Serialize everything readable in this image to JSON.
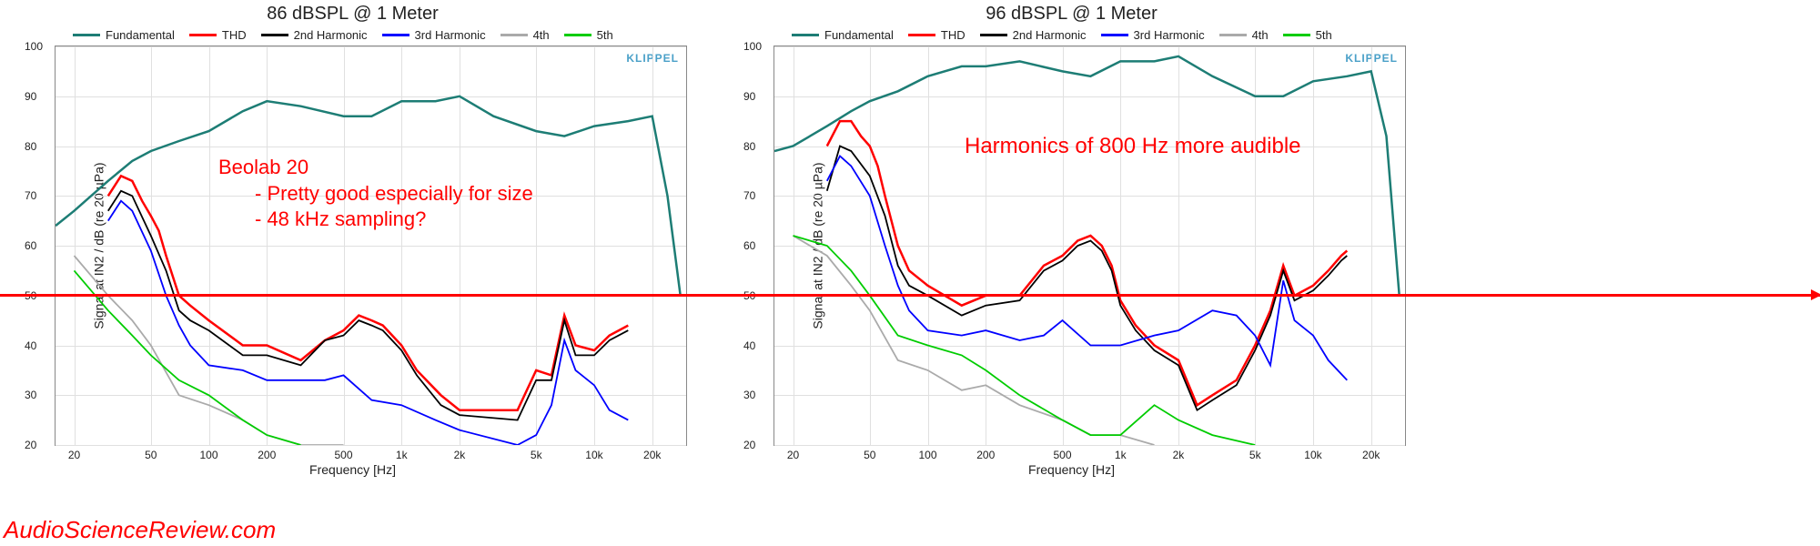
{
  "source_watermark": "AudioScienceReview.com",
  "brand_label": "KLIPPEL",
  "reference_line_db": 50,
  "chart_data": [
    {
      "type": "line",
      "title": "86 dBSPL @ 1 Meter",
      "xlabel": "Frequency [Hz]",
      "ylabel": "Signal at IN2 / dB (re 20 µPa)",
      "xscale": "log",
      "xlim": [
        16,
        30000
      ],
      "ylim": [
        20,
        100
      ],
      "xticks": [
        20,
        50,
        100,
        200,
        500,
        1000,
        2000,
        5000,
        10000,
        20000
      ],
      "xtick_labels": [
        "20",
        "50",
        "100",
        "200",
        "500",
        "1k",
        "2k",
        "5k",
        "10k",
        "20k"
      ],
      "yticks": [
        20,
        30,
        40,
        50,
        60,
        70,
        80,
        90,
        100
      ],
      "legend": [
        {
          "name": "Fundamental",
          "color": "#1d7d75"
        },
        {
          "name": "THD",
          "color": "#ff0000"
        },
        {
          "name": "2nd Harmonic",
          "color": "#000000"
        },
        {
          "name": "3rd Harmonic",
          "color": "#0000ff"
        },
        {
          "name": "4th",
          "color": "#aaaaaa"
        },
        {
          "name": "5th",
          "color": "#00cc00"
        }
      ],
      "annotations": [
        "Beolab 20",
        "- Pretty good especially for size",
        "- 48 kHz sampling?"
      ],
      "series": [
        {
          "name": "Fundamental",
          "color": "#1d7d75",
          "x": [
            16,
            20,
            30,
            40,
            50,
            70,
            100,
            150,
            200,
            300,
            500,
            700,
            1000,
            1500,
            2000,
            3000,
            5000,
            7000,
            10000,
            15000,
            20000,
            24000,
            28000
          ],
          "y": [
            64,
            67,
            73,
            77,
            79,
            81,
            83,
            87,
            89,
            88,
            86,
            86,
            89,
            89,
            90,
            86,
            83,
            82,
            84,
            85,
            86,
            70,
            50
          ]
        },
        {
          "name": "THD",
          "color": "#ff0000",
          "x": [
            30,
            35,
            40,
            45,
            50,
            55,
            60,
            70,
            80,
            100,
            150,
            200,
            300,
            400,
            500,
            600,
            700,
            800,
            1000,
            1200,
            1600,
            2000,
            4000,
            5000,
            6000,
            7000,
            8000,
            10000,
            12000,
            15000
          ],
          "y": [
            70,
            74,
            73,
            69,
            66,
            63,
            58,
            50,
            48,
            45,
            40,
            40,
            37,
            41,
            43,
            46,
            45,
            44,
            40,
            35,
            30,
            27,
            27,
            35,
            34,
            46,
            40,
            39,
            42,
            44
          ]
        },
        {
          "name": "2nd Harmonic",
          "color": "#000000",
          "x": [
            30,
            35,
            40,
            50,
            60,
            70,
            80,
            100,
            150,
            200,
            300,
            400,
            500,
            600,
            700,
            800,
            1000,
            1200,
            1600,
            2000,
            4000,
            5000,
            6000,
            7000,
            8000,
            10000,
            12000,
            15000
          ],
          "y": [
            67,
            71,
            70,
            62,
            55,
            47,
            45,
            43,
            38,
            38,
            36,
            41,
            42,
            45,
            44,
            43,
            39,
            34,
            28,
            26,
            25,
            33,
            33,
            45,
            38,
            38,
            41,
            43
          ]
        },
        {
          "name": "3rd Harmonic",
          "color": "#0000ff",
          "x": [
            30,
            35,
            40,
            50,
            60,
            70,
            80,
            100,
            150,
            200,
            300,
            400,
            500,
            700,
            1000,
            1500,
            2000,
            4000,
            5000,
            6000,
            7000,
            8000,
            10000,
            12000,
            15000
          ],
          "y": [
            65,
            69,
            67,
            59,
            50,
            44,
            40,
            36,
            35,
            33,
            33,
            33,
            34,
            29,
            28,
            25,
            23,
            20,
            22,
            28,
            41,
            35,
            32,
            27,
            25
          ]
        },
        {
          "name": "4th",
          "color": "#aaaaaa",
          "x": [
            20,
            30,
            40,
            50,
            70,
            100,
            150,
            200,
            300,
            500
          ],
          "y": [
            58,
            50,
            45,
            40,
            30,
            28,
            25,
            22,
            20,
            20
          ]
        },
        {
          "name": "5th",
          "color": "#00cc00",
          "x": [
            20,
            30,
            40,
            50,
            70,
            100,
            150,
            200,
            300
          ],
          "y": [
            55,
            47,
            42,
            38,
            33,
            30,
            25,
            22,
            20
          ]
        }
      ]
    },
    {
      "type": "line",
      "title": "96 dBSPL @ 1 Meter",
      "xlabel": "Frequency [Hz]",
      "ylabel": "Signal at IN2 / dB (re 20 µPa)",
      "xscale": "log",
      "xlim": [
        16,
        30000
      ],
      "ylim": [
        20,
        100
      ],
      "xticks": [
        20,
        50,
        100,
        200,
        500,
        1000,
        2000,
        5000,
        10000,
        20000
      ],
      "xtick_labels": [
        "20",
        "50",
        "100",
        "200",
        "500",
        "1k",
        "2k",
        "5k",
        "10k",
        "20k"
      ],
      "yticks": [
        20,
        30,
        40,
        50,
        60,
        70,
        80,
        90,
        100
      ],
      "legend": [
        {
          "name": "Fundamental",
          "color": "#1d7d75"
        },
        {
          "name": "THD",
          "color": "#ff0000"
        },
        {
          "name": "2nd Harmonic",
          "color": "#000000"
        },
        {
          "name": "3rd Harmonic",
          "color": "#0000ff"
        },
        {
          "name": "4th",
          "color": "#aaaaaa"
        },
        {
          "name": "5th",
          "color": "#00cc00"
        }
      ],
      "annotations": [
        "Harmonics of 800 Hz more audible"
      ],
      "series": [
        {
          "name": "Fundamental",
          "color": "#1d7d75",
          "x": [
            16,
            20,
            30,
            40,
            50,
            70,
            100,
            150,
            200,
            300,
            500,
            700,
            1000,
            1500,
            2000,
            3000,
            5000,
            7000,
            10000,
            15000,
            20000,
            24000,
            28000
          ],
          "y": [
            79,
            80,
            84,
            87,
            89,
            91,
            94,
            96,
            96,
            97,
            95,
            94,
            97,
            97,
            98,
            94,
            90,
            90,
            93,
            94,
            95,
            82,
            50
          ]
        },
        {
          "name": "THD",
          "color": "#ff0000",
          "x": [
            30,
            35,
            40,
            45,
            50,
            55,
            60,
            70,
            80,
            100,
            150,
            200,
            300,
            400,
            500,
            600,
            700,
            800,
            900,
            1000,
            1200,
            1500,
            2000,
            2500,
            3000,
            4000,
            5000,
            6000,
            7000,
            8000,
            10000,
            12000,
            14000,
            15000
          ],
          "y": [
            80,
            85,
            85,
            82,
            80,
            76,
            70,
            60,
            55,
            52,
            48,
            50,
            50,
            56,
            58,
            61,
            62,
            60,
            56,
            49,
            44,
            40,
            37,
            28,
            30,
            33,
            40,
            47,
            56,
            50,
            52,
            55,
            58,
            59
          ]
        },
        {
          "name": "2nd Harmonic",
          "color": "#000000",
          "x": [
            30,
            35,
            40,
            50,
            60,
            70,
            80,
            100,
            150,
            200,
            300,
            400,
            500,
            600,
            700,
            800,
            900,
            1000,
            1200,
            1500,
            2000,
            2500,
            3000,
            4000,
            5000,
            6000,
            7000,
            8000,
            10000,
            12000,
            14000,
            15000
          ],
          "y": [
            71,
            80,
            79,
            74,
            66,
            56,
            52,
            50,
            46,
            48,
            49,
            55,
            57,
            60,
            61,
            59,
            55,
            48,
            43,
            39,
            36,
            27,
            29,
            32,
            39,
            46,
            55,
            49,
            51,
            54,
            57,
            58
          ]
        },
        {
          "name": "3rd Harmonic",
          "color": "#0000ff",
          "x": [
            30,
            35,
            40,
            50,
            60,
            70,
            80,
            100,
            150,
            200,
            300,
            400,
            500,
            700,
            1000,
            1500,
            2000,
            3000,
            4000,
            5000,
            6000,
            7000,
            8000,
            10000,
            12000,
            15000
          ],
          "y": [
            73,
            78,
            76,
            70,
            60,
            52,
            47,
            43,
            42,
            43,
            41,
            42,
            45,
            40,
            40,
            42,
            43,
            47,
            46,
            42,
            36,
            53,
            45,
            42,
            37,
            33
          ]
        },
        {
          "name": "4th",
          "color": "#aaaaaa",
          "x": [
            20,
            30,
            40,
            50,
            70,
            100,
            150,
            200,
            300,
            500,
            700,
            1000,
            1500
          ],
          "y": [
            62,
            58,
            52,
            47,
            37,
            35,
            31,
            32,
            28,
            25,
            22,
            22,
            20
          ]
        },
        {
          "name": "5th",
          "color": "#00cc00",
          "x": [
            20,
            30,
            40,
            50,
            70,
            100,
            150,
            200,
            300,
            500,
            700,
            1000,
            1500,
            2000,
            3000,
            5000
          ],
          "y": [
            62,
            60,
            55,
            50,
            42,
            40,
            38,
            35,
            30,
            25,
            22,
            22,
            28,
            25,
            22,
            20
          ]
        }
      ]
    }
  ],
  "colors": {
    "fundamental": "#1d7d75",
    "thd": "#ff0000",
    "h2": "#000000",
    "h3": "#0000ff",
    "h4": "#aaaaaa",
    "h5": "#00cc00"
  }
}
